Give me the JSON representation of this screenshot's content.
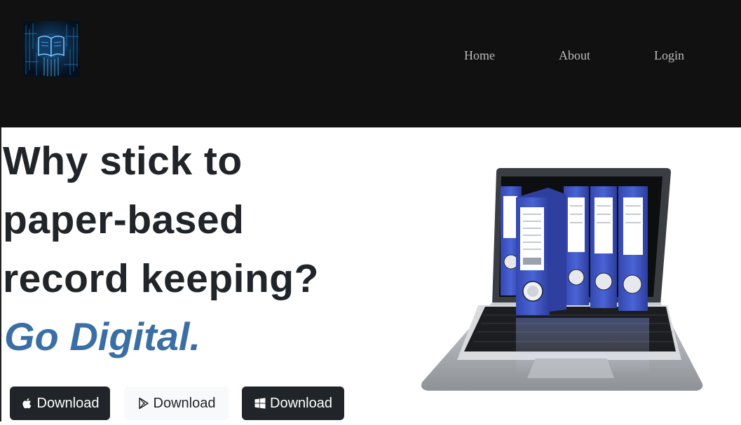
{
  "nav": {
    "logo_icon": "circuit-book-logo",
    "links": [
      {
        "label": "Home"
      },
      {
        "label": "About"
      },
      {
        "label": "Login"
      }
    ]
  },
  "hero": {
    "headline_lines": [
      "Why stick to",
      "paper-based",
      "record keeping?"
    ],
    "tagline": "Go Digital.",
    "tagline_color": "#3a6ea5",
    "image_icon": "laptop-binders-illustration"
  },
  "downloads": [
    {
      "label": "Download",
      "icon": "apple-icon",
      "style": "dark"
    },
    {
      "label": "Download",
      "icon": "google-play-icon",
      "style": "light"
    },
    {
      "label": "Download",
      "icon": "windows-icon",
      "style": "dark"
    }
  ],
  "colors": {
    "navbar_bg": "#111111",
    "text_dark": "#212529",
    "binder_blue": "#3e56c4"
  }
}
